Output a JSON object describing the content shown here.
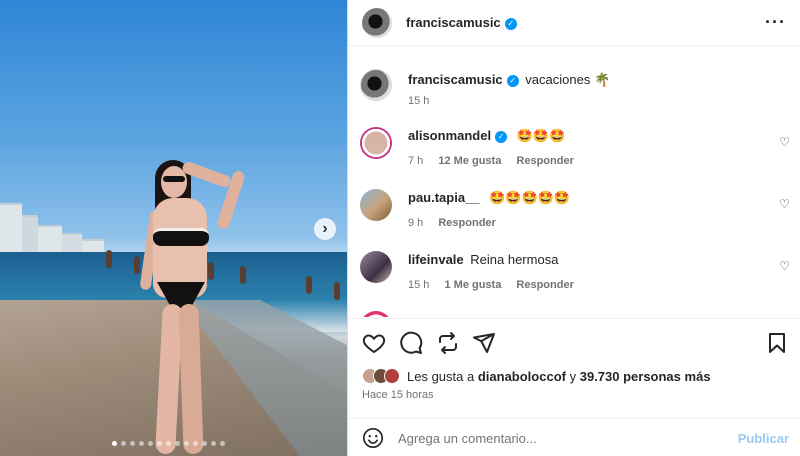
{
  "post": {
    "author": "franciscamusic",
    "more_icon": "more-horizontal-icon"
  },
  "caption": {
    "username": "franciscamusic",
    "text": "vacaciones 🌴",
    "time": "15 h"
  },
  "comments": [
    {
      "username": "alisonmandel",
      "verified": true,
      "text": "🤩🤩🤩",
      "time": "7 h",
      "likes": "12 Me gusta",
      "reply": "Responder"
    },
    {
      "username": "pau.tapia__",
      "verified": false,
      "text": "🤩🤩🤩🤩🤩",
      "time": "9 h",
      "likes": "",
      "reply": "Responder"
    },
    {
      "username": "lifeinvale",
      "verified": false,
      "text": "Reina hermosa",
      "time": "15 h",
      "likes": "1 Me gusta",
      "reply": "Responder"
    }
  ],
  "actions": {
    "like_icon": "heart-icon",
    "comment_icon": "comment-icon",
    "repost_icon": "repost-icon",
    "share_icon": "send-icon",
    "save_icon": "bookmark-icon"
  },
  "likes": {
    "prefix": "Les gusta a",
    "user": "dianaboloccof",
    "middle": "y",
    "count": "39.730 personas",
    "suffix": "más"
  },
  "posted_time": "Hace 15 horas",
  "add_comment": {
    "placeholder": "Agrega un comentario...",
    "publish": "Publicar"
  },
  "carousel": {
    "total": 13,
    "active": 1
  },
  "colors": {
    "accent": "#0095f6",
    "publish": "#9ac9f5",
    "muted": "#737373"
  }
}
